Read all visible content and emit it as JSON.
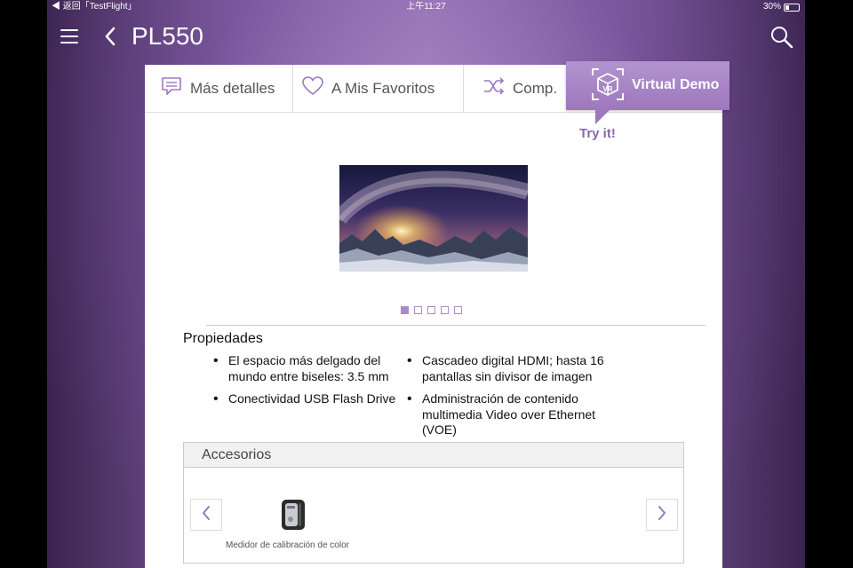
{
  "status_bar": {
    "back_app": "◀ 返回「TestFlight」",
    "time": "上午11:27",
    "battery": "30%",
    "battery_level": 0.3
  },
  "header": {
    "title": "PL550",
    "icons": [
      "menu-icon",
      "back-icon",
      "search-icon"
    ]
  },
  "tabs": [
    {
      "label": "Más detalles",
      "icon": "message-icon"
    },
    {
      "label": "A Mis Favoritos",
      "icon": "heart-icon"
    },
    {
      "label": "Comp.",
      "icon": "shuffle-icon"
    }
  ],
  "virtual_demo": {
    "label": "Virtual Demo",
    "icon_text": "VR",
    "hint": "Try it!"
  },
  "carousel": {
    "count": 5,
    "active_index": 0
  },
  "properties": {
    "title": "Propiedades",
    "items": [
      "El espacio más delgado del mundo entre biseles: 3.5 mm",
      "Conectividad USB Flash Drive",
      "Cascadeo digital HDMI; hasta 16 pantallas sin divisor de imagen",
      "Administración de contenido multimedia Video over Ethernet (VOE)"
    ]
  },
  "accessories": {
    "title": "Accesorios",
    "items": [
      {
        "name": "Medidor de calibración de color"
      }
    ]
  },
  "colors": {
    "accent": "#9d78bd",
    "tryit": "#8a68ad",
    "background_purple": "#7d5a9c"
  }
}
